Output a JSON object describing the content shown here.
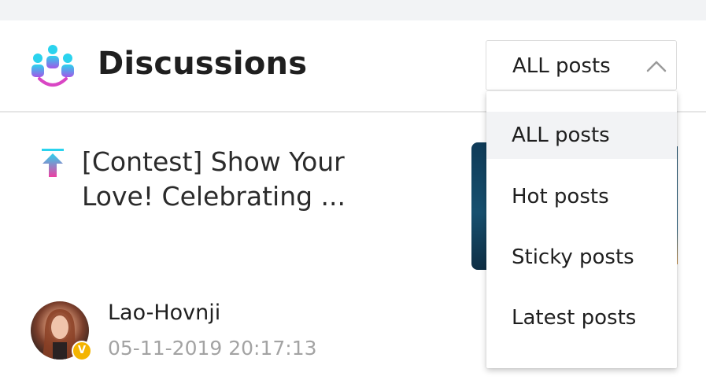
{
  "header": {
    "title": "Discussions",
    "logo_icon": "community-people-icon"
  },
  "sort": {
    "selected": "ALL posts",
    "options": [
      "ALL posts",
      "Hot posts",
      "Sticky posts",
      "Latest posts"
    ]
  },
  "post": {
    "title_line1": "[Contest] Show Your",
    "title_line2": "Love! Celebrating ...",
    "sticky_icon": "pinned-arrow-up-icon",
    "author": "Lao-Hovnji",
    "timestamp": "05-11-2019 20:17:13",
    "badge": "V"
  },
  "colors": {
    "accent_cyan": "#24c4e6",
    "accent_pink": "#e83ea8",
    "badge_gold": "#f4b400",
    "selected_bg": "#f2f3f5"
  }
}
